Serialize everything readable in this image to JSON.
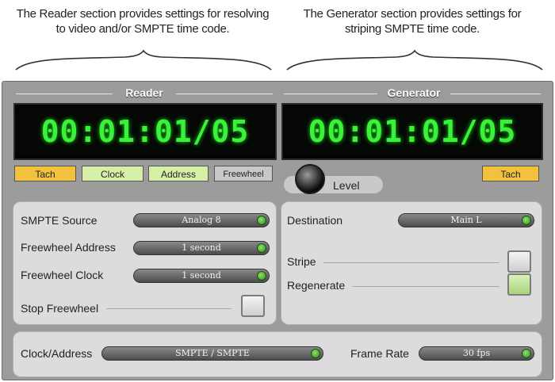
{
  "captions": {
    "reader": "The Reader section provides settings for resolving to video and/or SMPTE time code.",
    "generator": "The Generator section provides settings for striping SMPTE time code."
  },
  "reader": {
    "title": "Reader",
    "timecode": "00:01:01/05",
    "indicators": {
      "tach": "Tach",
      "clock": "Clock",
      "address": "Address",
      "freewheel": "Freewheel"
    },
    "smpte_source_label": "SMPTE Source",
    "smpte_source_value": "Analog 8",
    "freewheel_address_label": "Freewheel Address",
    "freewheel_address_value": "1 second",
    "freewheel_clock_label": "Freewheel Clock",
    "freewheel_clock_value": "1 second",
    "stop_freewheel_label": "Stop Freewheel"
  },
  "generator": {
    "title": "Generator",
    "timecode": "00:01:01/05",
    "tach": "Tach",
    "level_label": "Level",
    "destination_label": "Destination",
    "destination_value": "Main L",
    "stripe_label": "Stripe",
    "regenerate_label": "Regenerate"
  },
  "bottom": {
    "clock_address_label": "Clock/Address",
    "clock_address_value": "SMPTE / SMPTE",
    "frame_rate_label": "Frame Rate",
    "frame_rate_value": "30 fps"
  },
  "colors": {
    "lcd_text": "#3bf23b",
    "indicator_yellow": "#f2c23c",
    "indicator_green": "#d6f0a8",
    "select_arrow": "#2f8f1b"
  }
}
